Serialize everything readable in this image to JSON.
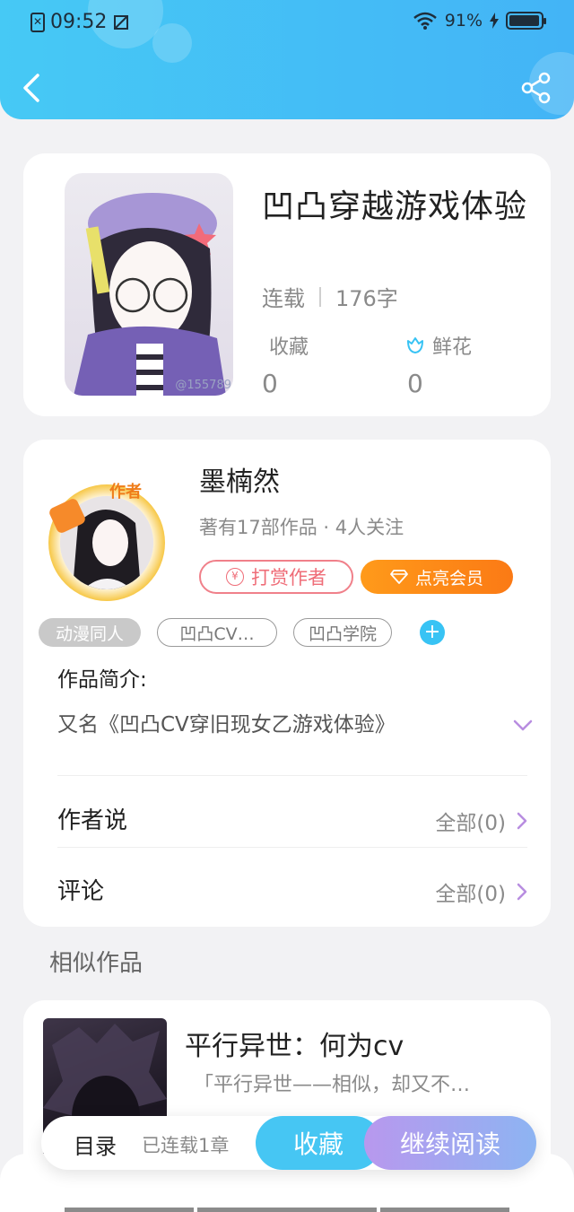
{
  "status_bar": {
    "time": "09:52",
    "battery": "91%",
    "battery_level": 0.91
  },
  "book": {
    "title": "凹凸穿越游戏体验",
    "status": "连载",
    "word_count": "176字",
    "favorites_label": "收藏",
    "favorites_value": "0",
    "flowers_label": "鲜花",
    "flowers_value": "0",
    "cover_watermark": "@155789"
  },
  "author": {
    "name": "墨楠然",
    "subtitle": "著有17部作品 · 4人关注",
    "badge": "作者",
    "tip_button": "打赏作者",
    "vip_button": "点亮会员"
  },
  "tags": [
    "动漫同人",
    "凹凸CV…",
    "凹凸学院"
  ],
  "intro": {
    "title": "作品简介:",
    "text": "又名《凹凸CV穿旧现女乙游戏体验》"
  },
  "rows": {
    "author_says": {
      "label": "作者说",
      "value": "全部(0)"
    },
    "comments": {
      "label": "评论",
      "value": "全部(0)"
    }
  },
  "similar": {
    "section_title": "相似作品",
    "items": [
      {
        "title": "平行异世：何为cv",
        "desc": "「平行异世——相似，却又不…"
      }
    ]
  },
  "bottom_bar": {
    "toc": "目录",
    "chapters": "已连载1章",
    "favorite": "收藏",
    "continue": "继续阅读"
  },
  "colors": {
    "header": "#43bff5",
    "accent_blue": "#38c3f4",
    "vip_orange": "#fb8a18",
    "tip_red": "#ef6d78",
    "read_purple": "#b898ee"
  }
}
